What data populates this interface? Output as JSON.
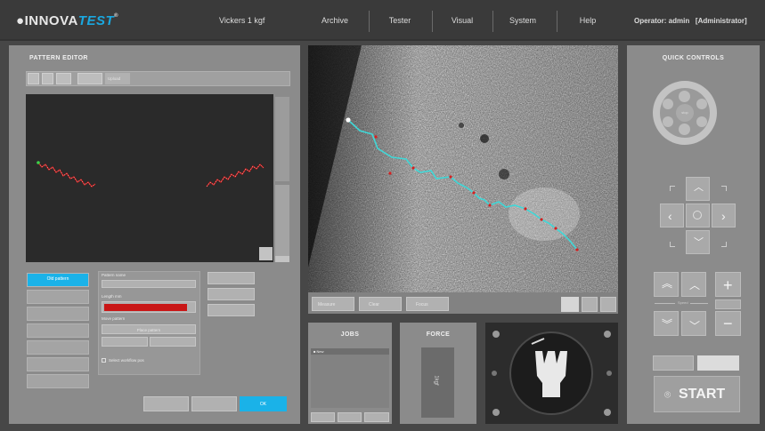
{
  "header": {
    "logo_prefix": "INNOVA",
    "logo_suffix": "TEST",
    "logo_reg": "®",
    "test_mode": "Vickers 1 kgf",
    "menu": [
      "Archive",
      "Tester",
      "Visual",
      "System",
      "Help"
    ],
    "operator": "Operator: admin",
    "role": "[Administrator]"
  },
  "pattern_editor": {
    "title": "PATTERN EDITOR",
    "toolbar": [
      "",
      "",
      "",
      "",
      "Upload"
    ],
    "side_buttons": [
      {
        "label": "Old pattern",
        "active": true
      },
      {
        "label": "",
        "active": false
      },
      {
        "label": "",
        "active": false
      },
      {
        "label": "",
        "active": false
      },
      {
        "label": "",
        "active": false
      },
      {
        "label": "",
        "active": false
      },
      {
        "label": "",
        "active": false
      }
    ],
    "pattern_name_label": "Pattern name",
    "pattern_name_value": "",
    "length_label": "Length mm",
    "move_pattern_label": "Move pattern",
    "place_button": "Place pattern",
    "auto_checkbox": "Select workflow pos",
    "right_buttons": [
      "",
      "",
      ""
    ],
    "bottom_buttons": [
      "",
      "",
      "OK"
    ]
  },
  "camera": {
    "toolbar_left": [
      "Measure",
      "Clear",
      "Focus"
    ],
    "toolbar_right": [
      "",
      "",
      ""
    ]
  },
  "jobs": {
    "title": "JOBS",
    "items": [
      "New"
    ]
  },
  "force": {
    "title": "FORCE",
    "value": "1kgf"
  },
  "quick_controls": {
    "title": "QUICK CONTROLS",
    "wheel_center": "stop",
    "dpad_center": "",
    "speed_label": "Speed",
    "start_label": "START",
    "icons": {
      "up": "▲",
      "down": "▼",
      "left": "◀",
      "right": "▶",
      "fast_up": "⏫",
      "fast_down": "⏬",
      "plus": "+",
      "minus": "−",
      "start": "⌾"
    }
  },
  "colors": {
    "accent": "#1ab2e8",
    "panel": "#8b8b8b",
    "background": "#474747",
    "pattern_red": "#c91616",
    "trace_cyan": "#3fd8d8"
  }
}
